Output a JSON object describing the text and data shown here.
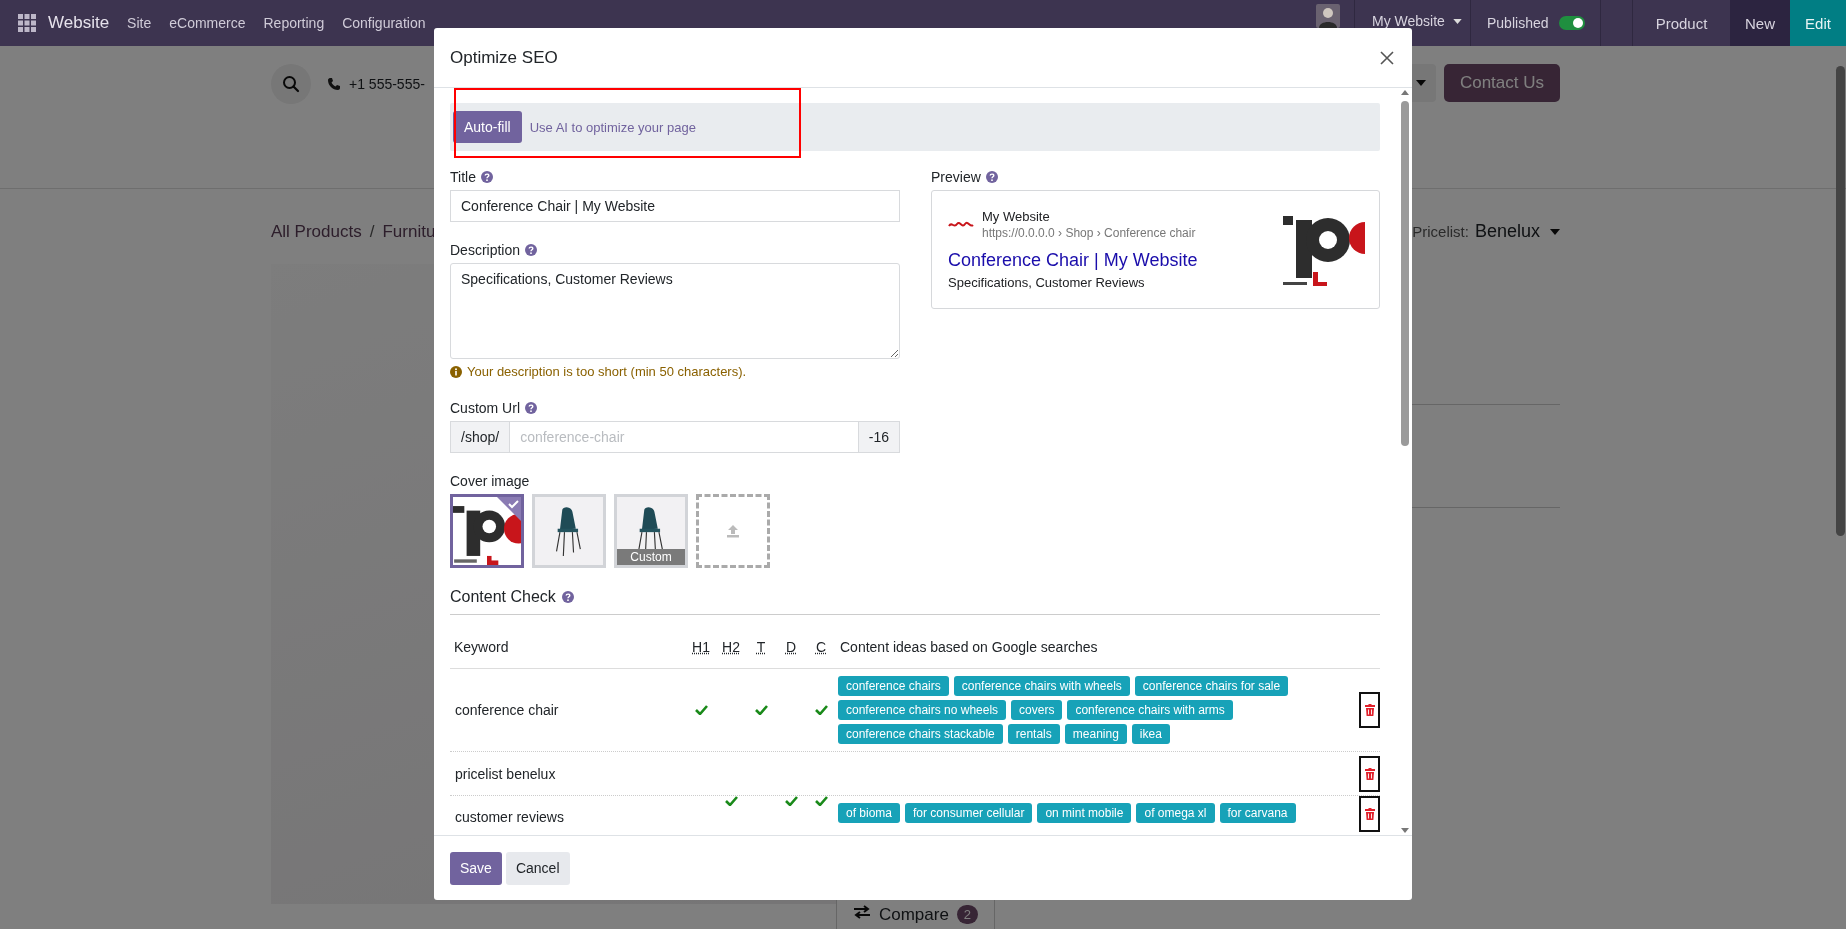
{
  "navbar": {
    "app_name": "Website",
    "menus": [
      "Site",
      "eCommerce",
      "Reporting",
      "Configuration"
    ],
    "website_switcher": "My Website",
    "published": {
      "label": "Published",
      "on": true
    },
    "buttons": [
      {
        "label": "Product",
        "kind": "plain"
      },
      {
        "label": "New",
        "kind": "dark"
      },
      {
        "label": "Edit",
        "kind": "primary"
      }
    ]
  },
  "page": {
    "phone": "+1 555-555-",
    "contact_button": "Contact Us",
    "breadcrumb": {
      "items": [
        "All Products",
        "Furnitu"
      ],
      "separator": "/"
    },
    "pricelist_label": "Pricelist:",
    "pricelist_value": "Benelux",
    "compare": {
      "label": "Compare",
      "count": "2"
    }
  },
  "dialog": {
    "title": "Optimize SEO",
    "autofill": {
      "button": "Auto-fill",
      "hint": "Use AI to optimize your page"
    },
    "title_field": {
      "label": "Title",
      "value": "Conference Chair | My Website"
    },
    "description_field": {
      "label": "Description",
      "value": "Specifications, Customer Reviews",
      "warning": "Your description is too short (min 50 characters)."
    },
    "url_field": {
      "label": "Custom Url",
      "prefix": "/shop/",
      "placeholder": "conference-chair",
      "suffix": "-16"
    },
    "cover_image": {
      "label": "Cover image",
      "options": [
        {
          "kind": "logo",
          "selected": true
        },
        {
          "kind": "picture",
          "selected": false
        },
        {
          "kind": "picture",
          "selected": false,
          "caption": "Custom"
        },
        {
          "kind": "upload",
          "selected": false
        }
      ]
    },
    "preview": {
      "label": "Preview",
      "site_name": "My Website",
      "url": "https://0.0.0.0 › Shop › Conference chair",
      "title": "Conference Chair | My Website",
      "description": "Specifications, Customer Reviews"
    },
    "content_check": {
      "title": "Content Check",
      "columns": [
        "Keyword",
        "H1",
        "H2",
        "T",
        "D",
        "C",
        "Content ideas based on Google searches"
      ],
      "rows": [
        {
          "keyword": "conference chair",
          "checks": [
            true,
            false,
            true,
            false,
            true
          ],
          "ideas": [
            "conference chairs",
            "conference chairs with wheels",
            "conference chairs for sale",
            "conference chairs no wheels",
            "covers",
            "conference chairs with arms",
            "conference chairs stackable",
            "rentals",
            "meaning",
            "ikea"
          ]
        },
        {
          "keyword": "pricelist benelux",
          "checks": [
            false,
            false,
            false,
            false,
            false
          ],
          "ideas": []
        },
        {
          "keyword": "customer reviews",
          "checks": [
            false,
            true,
            false,
            true,
            true
          ],
          "ideas": [
            "of bioma",
            "for consumer cellular",
            "on mint mobile",
            "of omega xl",
            "for carvana"
          ]
        }
      ]
    },
    "footer_buttons": [
      {
        "label": "Save",
        "kind": "primary"
      },
      {
        "label": "Cancel",
        "kind": "secondary"
      }
    ]
  }
}
